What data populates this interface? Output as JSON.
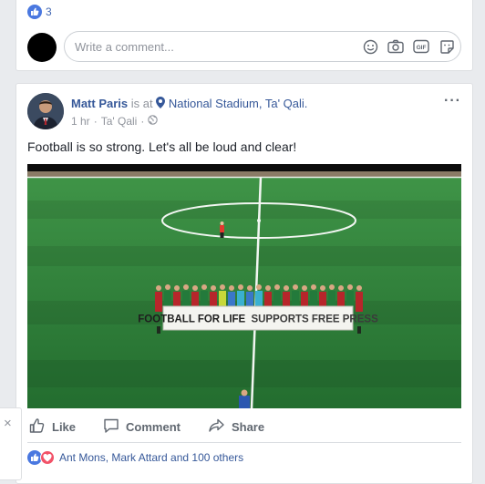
{
  "top_post": {
    "like_count": "3",
    "comment_placeholder": "Write a comment..."
  },
  "icons": {
    "like": "thumbs-up-icon",
    "love": "heart-icon",
    "emoji": "smiley-icon",
    "camera": "camera-icon",
    "gif": "gif-icon",
    "sticker": "sticker-icon",
    "location": "map-pin-icon",
    "globe": "globe-icon",
    "more": "more-dots-icon",
    "close": "close-icon"
  },
  "post": {
    "author": "Matt Paris",
    "is_at": "is at",
    "place": "National Stadium, Ta' Qali.",
    "time": "1 hr",
    "location": "Ta' Qali",
    "meta_sep": "·",
    "more": "···",
    "text": "Football is so strong. Let's all be loud and clear!",
    "banner_text_bold": "FOOTBALL FOR LIFE",
    "banner_text_rest": "SUPPORTS FREE PRESS",
    "actions": {
      "like": "Like",
      "comment": "Comment",
      "share": "Share"
    },
    "reactions_text": "Ant Mons, Mark Attard and 100 others"
  },
  "close_label": "×",
  "colors": {
    "brand_blue": "#4267b2",
    "link_blue": "#365899",
    "pitch_green": "#2a7a3a",
    "love_red": "#f25268"
  }
}
